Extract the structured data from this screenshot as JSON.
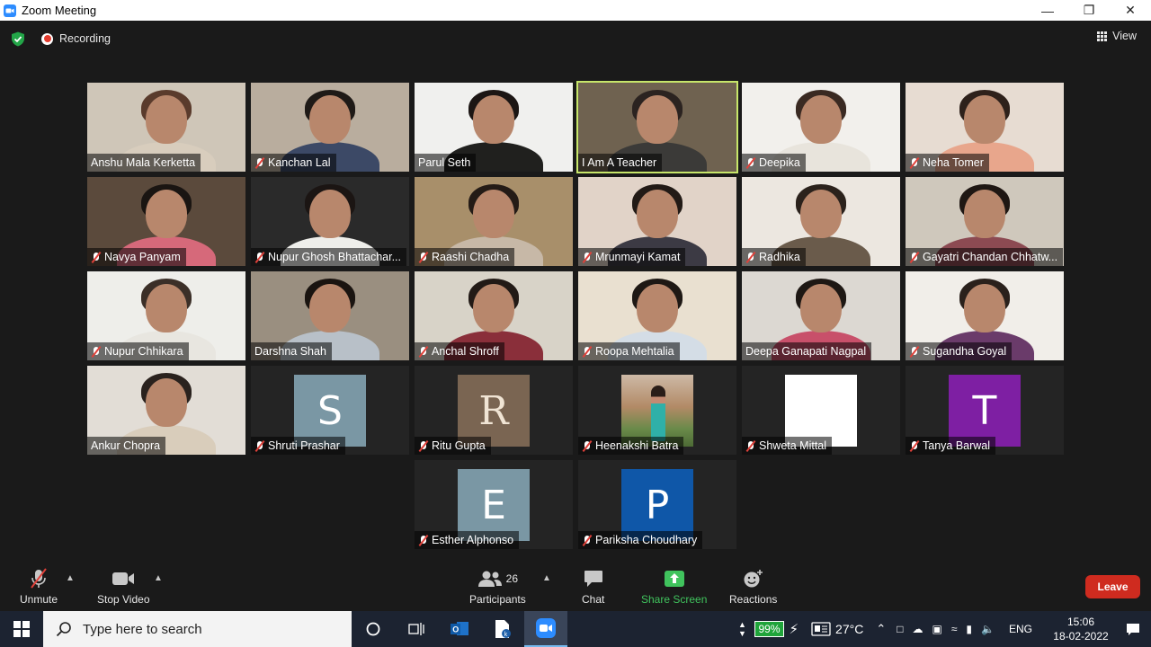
{
  "window": {
    "title": "Zoom Meeting"
  },
  "topbar": {
    "recording_label": "Recording",
    "view_label": "View"
  },
  "colors": {
    "active_speaker_border": "#c7e66a",
    "share_screen_green": "#40c35d",
    "leave_red": "#cf2b1f",
    "recording_red": "#e33b2e"
  },
  "participants": [
    {
      "name": "Anshu Mala Kerketta",
      "muted": false,
      "type": "video"
    },
    {
      "name": "Kanchan Lal",
      "muted": true,
      "type": "video"
    },
    {
      "name": "Parul Seth",
      "muted": false,
      "type": "video"
    },
    {
      "name": "I Am A Teacher",
      "muted": false,
      "type": "video",
      "active_speaker": true
    },
    {
      "name": "Deepika",
      "muted": true,
      "type": "video"
    },
    {
      "name": "Neha Tomer",
      "muted": true,
      "type": "video"
    },
    {
      "name": "Navya Panyam",
      "muted": true,
      "type": "video"
    },
    {
      "name": "Nupur Ghosh Bhattachar...",
      "muted": true,
      "type": "video"
    },
    {
      "name": "Raashi Chadha",
      "muted": true,
      "type": "video"
    },
    {
      "name": "Mrunmayi Kamat",
      "muted": true,
      "type": "video"
    },
    {
      "name": "Radhika",
      "muted": true,
      "type": "video"
    },
    {
      "name": "Gayatri Chandan Chhatw...",
      "muted": true,
      "type": "video"
    },
    {
      "name": "Nupur Chhikara",
      "muted": true,
      "type": "video"
    },
    {
      "name": "Darshna Shah",
      "muted": false,
      "type": "video"
    },
    {
      "name": "Anchal Shroff",
      "muted": true,
      "type": "video"
    },
    {
      "name": "Roopa Mehtalia",
      "muted": true,
      "type": "video"
    },
    {
      "name": "Deepa Ganapati Nagpal",
      "muted": false,
      "type": "video"
    },
    {
      "name": "Sugandha Goyal",
      "muted": true,
      "type": "video"
    },
    {
      "name": "Ankur Chopra",
      "muted": false,
      "type": "video"
    },
    {
      "name": "Shruti Prashar",
      "muted": true,
      "type": "avatar",
      "initial": "S",
      "avatar_color": "#7a97a4"
    },
    {
      "name": "Ritu Gupta",
      "muted": true,
      "type": "avatar",
      "initial": "R",
      "avatar_color": "#7a6552"
    },
    {
      "name": "Heenakshi Batra",
      "muted": true,
      "type": "photo"
    },
    {
      "name": "Shweta Mittal",
      "muted": true,
      "type": "blank"
    },
    {
      "name": "Tanya Barwal",
      "muted": true,
      "type": "avatar",
      "initial": "T",
      "avatar_color": "#7e1fa3"
    },
    {
      "name": "Esther Alphonso",
      "muted": true,
      "type": "avatar",
      "initial": "E",
      "avatar_color": "#7a97a4"
    },
    {
      "name": "Pariksha Choudhary",
      "muted": true,
      "type": "avatar",
      "initial": "P",
      "avatar_color": "#0f57a8"
    }
  ],
  "toolbar": {
    "unmute_label": "Unmute",
    "stop_video_label": "Stop Video",
    "participants_label": "Participants",
    "participants_count": "26",
    "chat_label": "Chat",
    "share_screen_label": "Share Screen",
    "reactions_label": "Reactions",
    "leave_label": "Leave"
  },
  "taskbar": {
    "search_placeholder": "Type here to search",
    "battery": "99%",
    "temperature": "27°C",
    "language": "ENG",
    "time": "15:06",
    "date": "18-02-2022"
  }
}
